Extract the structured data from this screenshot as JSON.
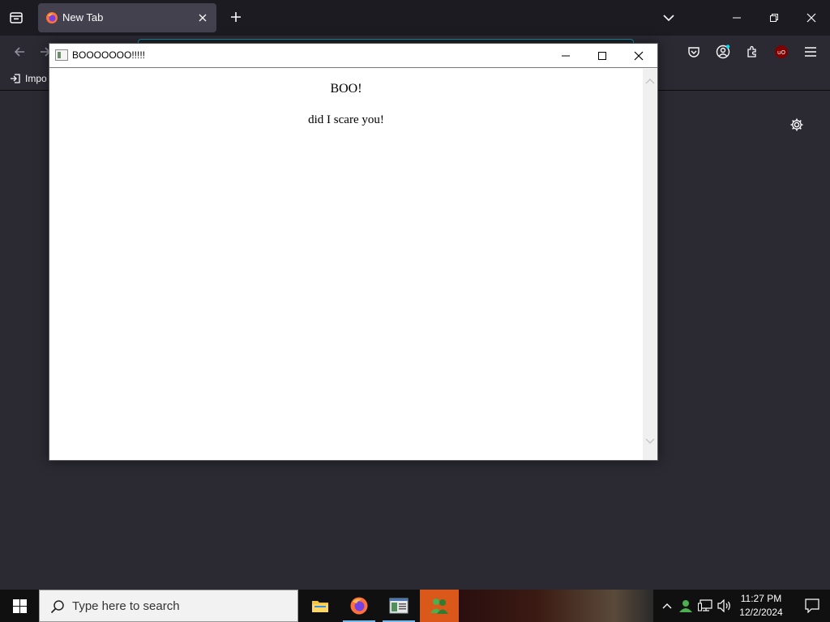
{
  "browser": {
    "tab_title": "New Tab",
    "bookmark_label": "Impo"
  },
  "popup": {
    "title": "BOOOOOOO!!!!!",
    "heading": "BOO!",
    "text": "did I scare you!"
  },
  "taskbar": {
    "search_placeholder": "Type here to search",
    "time": "11:27 PM",
    "date": "12/2/2024"
  },
  "colors": {
    "browser_bg": "#1c1b22",
    "toolbar_bg": "#2b2a33",
    "tab_active": "#42414d",
    "popup_bg": "#ffffff",
    "taskbar_bg": "#101010"
  }
}
